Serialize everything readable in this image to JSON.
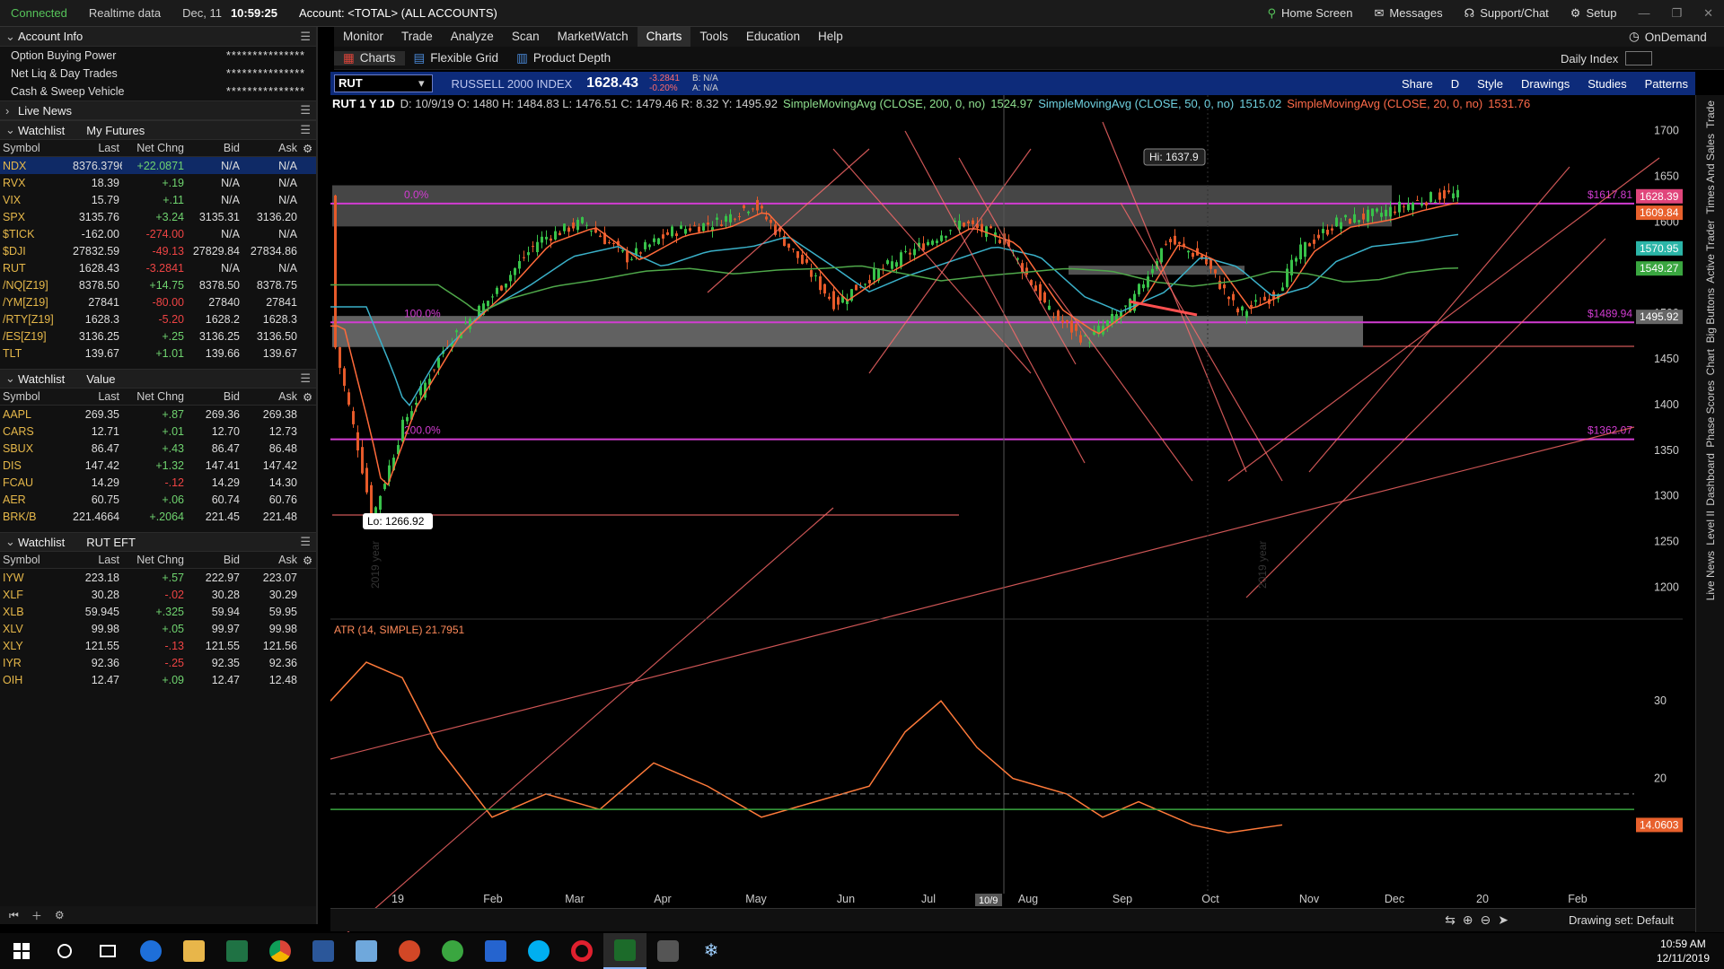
{
  "status": {
    "connected": "Connected",
    "realtime": "Realtime data",
    "date": "Dec, 11",
    "time": "10:59:25",
    "account": "Account: <TOTAL> (ALL ACCOUNTS)",
    "home": "Home Screen",
    "messages": "Messages",
    "support": "Support/Chat",
    "setup": "Setup"
  },
  "account_info": {
    "title": "Account Info",
    "rows": [
      {
        "label": "Option Buying Power",
        "value": "***************"
      },
      {
        "label": "Net Liq & Day Trades",
        "value": "***************"
      },
      {
        "label": "Cash & Sweep Vehicle",
        "value": "***************"
      }
    ]
  },
  "live_news": "Live News",
  "watchlists": [
    {
      "title": "Watchlist",
      "name": "My Futures",
      "headers": [
        "Symbol",
        "Last",
        "Net Chng",
        "Bid",
        "Ask"
      ],
      "rows": [
        [
          "NDX",
          "8376.3796",
          "+22.0871",
          "N/A",
          "N/A"
        ],
        [
          "RVX",
          "18.39",
          "+.19",
          "N/A",
          "N/A"
        ],
        [
          "VIX",
          "15.79",
          "+.11",
          "N/A",
          "N/A"
        ],
        [
          "SPX",
          "3135.76",
          "+3.24",
          "3135.31",
          "3136.20"
        ],
        [
          "$TICK",
          "-162.00",
          "-274.00",
          "N/A",
          "N/A"
        ],
        [
          "$DJI",
          "27832.59",
          "-49.13",
          "27829.84",
          "27834.86"
        ],
        [
          "RUT",
          "1628.43",
          "-3.2841",
          "N/A",
          "N/A"
        ],
        [
          "/NQ[Z19]",
          "8378.50",
          "+14.75",
          "8378.50",
          "8378.75"
        ],
        [
          "/YM[Z19]",
          "27841",
          "-80.00",
          "27840",
          "27841"
        ],
        [
          "/RTY[Z19]",
          "1628.3",
          "-5.20",
          "1628.2",
          "1628.3"
        ],
        [
          "/ES[Z19]",
          "3136.25",
          "+.25",
          "3136.25",
          "3136.50"
        ],
        [
          "TLT",
          "139.67",
          "+1.01",
          "139.66",
          "139.67"
        ]
      ]
    },
    {
      "title": "Watchlist",
      "name": "Value",
      "headers": [
        "Symbol",
        "Last",
        "Net Chng",
        "Bid",
        "Ask"
      ],
      "rows": [
        [
          "AAPL",
          "269.35",
          "+.87",
          "269.36",
          "269.38"
        ],
        [
          "CARS",
          "12.71",
          "+.01",
          "12.70",
          "12.73"
        ],
        [
          "SBUX",
          "86.47",
          "+.43",
          "86.47",
          "86.48"
        ],
        [
          "DIS",
          "147.42",
          "+1.32",
          "147.41",
          "147.42"
        ],
        [
          "FCAU",
          "14.29",
          "-.12",
          "14.29",
          "14.30"
        ],
        [
          "AER",
          "60.75",
          "+.06",
          "60.74",
          "60.76"
        ],
        [
          "BRK/B",
          "221.4664",
          "+.2064",
          "221.45",
          "221.48"
        ]
      ]
    },
    {
      "title": "Watchlist",
      "name": "RUT EFT",
      "headers": [
        "Symbol",
        "Last",
        "Net Chng",
        "Bid",
        "Ask"
      ],
      "rows": [
        [
          "IYW",
          "223.18",
          "+.57",
          "222.97",
          "223.07"
        ],
        [
          "XLF",
          "30.28",
          "-.02",
          "30.28",
          "30.29"
        ],
        [
          "XLB",
          "59.945",
          "+.325",
          "59.94",
          "59.95"
        ],
        [
          "XLV",
          "99.98",
          "+.05",
          "99.97",
          "99.98"
        ],
        [
          "XLY",
          "121.55",
          "-.13",
          "121.55",
          "121.56"
        ],
        [
          "IYR",
          "92.36",
          "-.25",
          "92.35",
          "92.36"
        ],
        [
          "OIH",
          "12.47",
          "+.09",
          "12.47",
          "12.48"
        ]
      ]
    }
  ],
  "menu": [
    "Monitor",
    "Trade",
    "Analyze",
    "Scan",
    "MarketWatch",
    "Charts",
    "Tools",
    "Education",
    "Help"
  ],
  "ondemand": "OnDemand",
  "subtabs": [
    "Charts",
    "Flexible Grid",
    "Product Depth"
  ],
  "daily_index": "Daily Index",
  "symbol": {
    "ticker": "RUT",
    "name": "RUSSELL 2000 INDEX",
    "price": "1628.43",
    "chg": "-3.2841",
    "chg_pct": "-0.20%",
    "bid": "B: N/A",
    "ask": "A: N/A",
    "tools": [
      "Share",
      "D",
      "Style",
      "Drawings",
      "Studies",
      "Patterns"
    ]
  },
  "study": {
    "label": "RUT 1 Y 1D",
    "ohlc": "D: 10/9/19   O: 1480   H: 1484.83   L: 1476.51   C: 1479.46   R: 8.32   Y: 1495.92",
    "sma200": "SimpleMovingAvg (CLOSE, 200, 0, no)",
    "sma200v": "1524.97",
    "sma50": "SimpleMovingAvg (CLOSE, 50, 0, no)",
    "sma50v": "1515.02",
    "sma20": "SimpleMovingAvg (CLOSE, 20, 0, no)",
    "sma20v": "1531.76",
    "atr": "ATR (14, SIMPLE)",
    "atrv": "21.7951",
    "hi": "Hi: 1637.9",
    "lo": "Lo: 1266.92",
    "fib": [
      "0.0%",
      "100.0%",
      "200.0%"
    ],
    "levels": [
      "$1617.81",
      "$1489.94",
      "$1362.07"
    ],
    "tags": [
      {
        "text": "1628.39",
        "color": "#e0457b"
      },
      {
        "text": "1609.84",
        "color": "#e8602c"
      },
      {
        "text": "1570.95",
        "color": "#2bb5a8"
      },
      {
        "text": "1549.27",
        "color": "#3aa640"
      },
      {
        "text": "1495.92",
        "color": "#666666"
      }
    ],
    "atr_tag": "14.0603",
    "drawing_set": "Drawing set: Default",
    "year_left": "2019 year",
    "year_right": "2019 year",
    "date_tag": "10/9"
  },
  "axis": {
    "y": [
      "1700",
      "1650",
      "1600",
      "1550",
      "1500",
      "1450",
      "1400",
      "1350",
      "1300",
      "1250",
      "1200"
    ],
    "x": [
      "19",
      "Feb",
      "Mar",
      "Apr",
      "May",
      "Jun",
      "Jul",
      "Aug",
      "Sep",
      "Oct",
      "Nov",
      "Dec",
      "20",
      "Feb"
    ],
    "atr_y": [
      "30",
      "20"
    ]
  },
  "right_dock": [
    "Trade",
    "Times And Sales",
    "Active Trader",
    "Big Buttons",
    "Chart",
    "Phase Scores",
    "Dashboard",
    "Level II",
    "Live News"
  ],
  "taskbar": {
    "time": "10:59 AM",
    "date": "12/11/2019"
  },
  "colors": {
    "bg": "#000000",
    "accent": "#0d2b7a",
    "fib": "#d23cd2",
    "candle_up": "#38c24a",
    "candle_down": "#e65a2a",
    "trend": "#ff6b6b"
  }
}
